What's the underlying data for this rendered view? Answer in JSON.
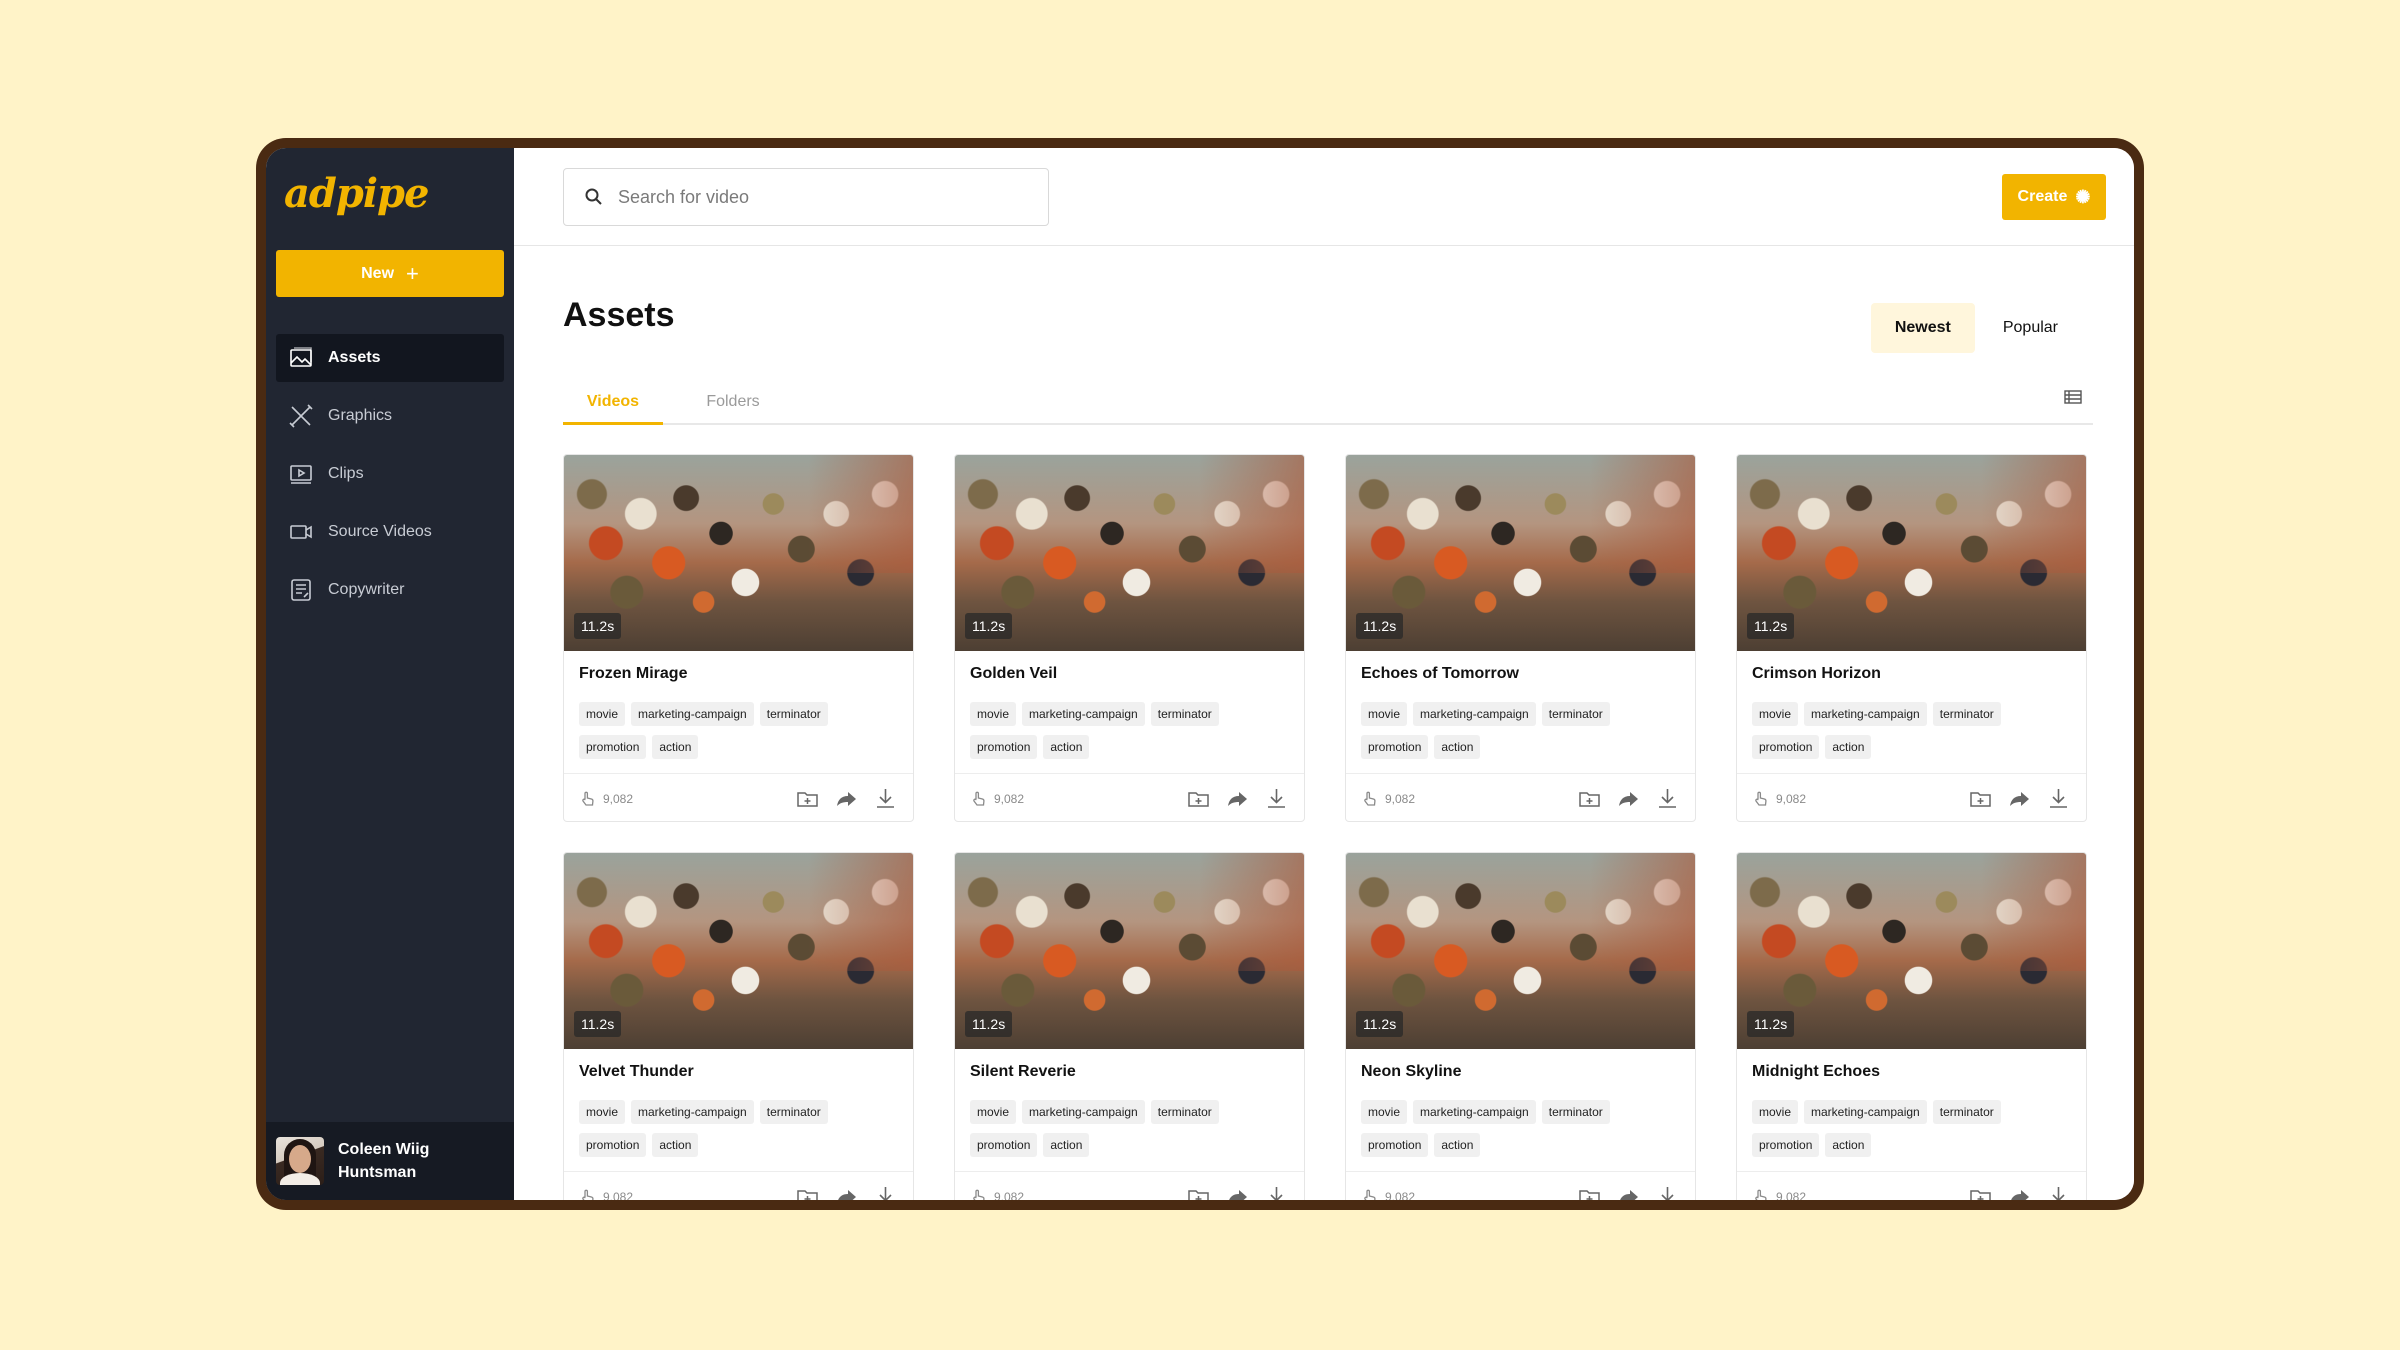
{
  "app": {
    "logo": "adpipe",
    "new_label": "New",
    "new_icon": "+"
  },
  "sidebar": {
    "items": [
      {
        "label": "Assets",
        "icon": "image-icon",
        "active": true
      },
      {
        "label": "Graphics",
        "icon": "pen-tool-icon",
        "active": false
      },
      {
        "label": "Clips",
        "icon": "clip-play-icon",
        "active": false
      },
      {
        "label": "Source Videos",
        "icon": "video-camera-icon",
        "active": false
      },
      {
        "label": "Copywriter",
        "icon": "document-edit-icon",
        "active": false
      }
    ],
    "user": {
      "name": "Coleen Wiig Huntsman"
    }
  },
  "header": {
    "search_placeholder": "Search for video",
    "create_label": "Create",
    "create_icon": "sparkle-icon"
  },
  "page": {
    "title": "Assets",
    "sort": [
      {
        "label": "Newest",
        "active": true
      },
      {
        "label": "Popular",
        "active": false
      }
    ],
    "tabs": [
      {
        "label": "Videos",
        "active": true
      },
      {
        "label": "Folders",
        "active": false
      }
    ]
  },
  "cards": [
    {
      "title": "Frozen Mirage",
      "duration": "11.2s",
      "views": "9,082",
      "tags": [
        "movie",
        "marketing-campaign",
        "terminator",
        "promotion",
        "action"
      ]
    },
    {
      "title": "Golden Veil",
      "duration": "11.2s",
      "views": "9,082",
      "tags": [
        "movie",
        "marketing-campaign",
        "terminator",
        "promotion",
        "action"
      ]
    },
    {
      "title": "Echoes of Tomorrow",
      "duration": "11.2s",
      "views": "9,082",
      "tags": [
        "movie",
        "marketing-campaign",
        "terminator",
        "promotion",
        "action"
      ]
    },
    {
      "title": "Crimson Horizon",
      "duration": "11.2s",
      "views": "9,082",
      "tags": [
        "movie",
        "marketing-campaign",
        "terminator",
        "promotion",
        "action"
      ]
    },
    {
      "title": "Velvet Thunder",
      "duration": "11.2s",
      "views": "9,082",
      "tags": [
        "movie",
        "marketing-campaign",
        "terminator",
        "promotion",
        "action"
      ]
    },
    {
      "title": "Silent Reverie",
      "duration": "11.2s",
      "views": "9,082",
      "tags": [
        "movie",
        "marketing-campaign",
        "terminator",
        "promotion",
        "action"
      ]
    },
    {
      "title": "Neon Skyline",
      "duration": "11.2s",
      "views": "9,082",
      "tags": [
        "movie",
        "marketing-campaign",
        "terminator",
        "promotion",
        "action"
      ]
    },
    {
      "title": "Midnight Echoes",
      "duration": "11.2s",
      "views": "9,082",
      "tags": [
        "movie",
        "marketing-campaign",
        "terminator",
        "promotion",
        "action"
      ]
    }
  ],
  "colors": {
    "accent": "#F2B400",
    "sidebar_bg": "#212632",
    "page_bg": "#FFF3C8"
  }
}
